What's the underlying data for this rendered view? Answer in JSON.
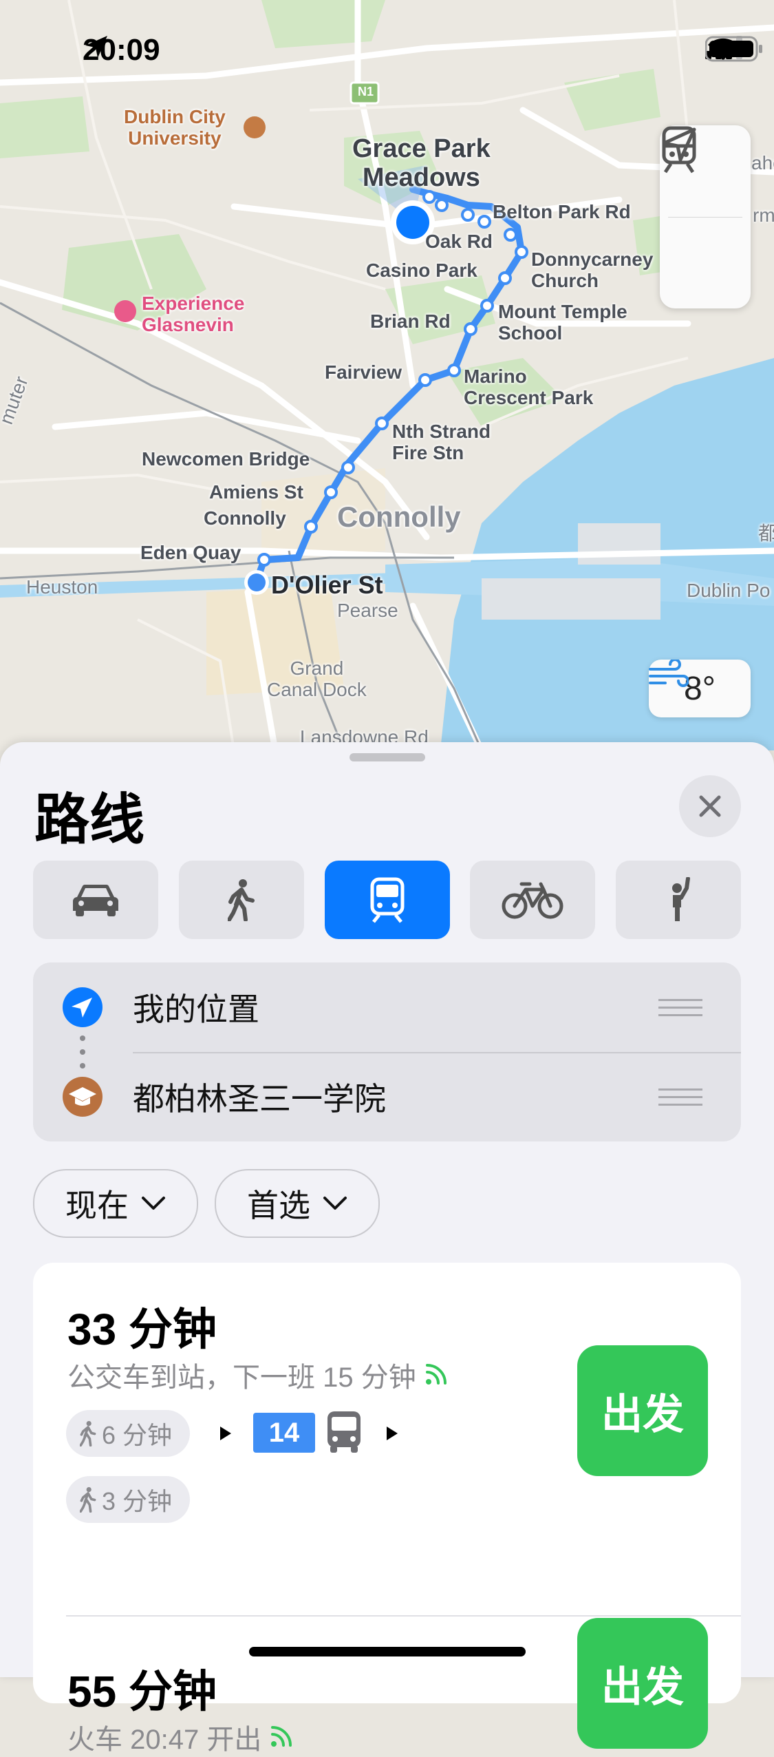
{
  "status_bar": {
    "time": "20:09"
  },
  "map": {
    "labels": {
      "dublin_city_university": "Dublin City\nUniversity",
      "grace_park": "Grace Park\nMeadows",
      "belton_park": "Belton Park Rd",
      "oak_rd": "Oak Rd",
      "casino_park": "Casino Park",
      "donnycarney": "Donnycarney\nChurch",
      "experience_glasnevin": "Experience\nGlasnevin",
      "brian_rd": "Brian Rd",
      "mount_temple": "Mount Temple\nSchool",
      "fairview": "Fairview",
      "marino": "Marino\nCrescent Park",
      "nth_strand": "Nth Strand\nFire Stn",
      "newcomen": "Newcomen Bridge",
      "amiens": "Amiens St",
      "connolly_small": "Connolly",
      "connolly_big": "Connolly",
      "eden_quay": "Eden Quay",
      "heuston": "Heuston",
      "dolier": "D'Olier St",
      "pearse": "Pearse",
      "grand_canal": "Grand\nCanal Dock",
      "lansdowne": "Lansdowne Rd",
      "dublin_port": "Dublin Po",
      "n1": "N1",
      "commuter": "muter",
      "edge_ahe": "ahe",
      "edge_rm": "rm",
      "edge_du": "都"
    },
    "weather_temp": "8°"
  },
  "sheet": {
    "title": "路线",
    "modes": [
      {
        "name": "car-icon",
        "active": false
      },
      {
        "name": "walk-icon",
        "active": false
      },
      {
        "name": "transit-icon",
        "active": true
      },
      {
        "name": "bike-icon",
        "active": false
      },
      {
        "name": "rideshare-icon",
        "active": false
      }
    ],
    "origin": "我的位置",
    "destination": "都柏林圣三一学院",
    "time_filter": "现在",
    "pref_filter": "首选",
    "routes": [
      {
        "duration": "33 分钟",
        "subtitle": "公交车到站，下一班 15 分钟",
        "walk1": "6 分钟",
        "bus": "14",
        "walk2": "3 分钟",
        "go": "出发"
      },
      {
        "duration": "55 分钟",
        "subtitle": "火车 20:47 开出",
        "go": "出发"
      }
    ]
  }
}
